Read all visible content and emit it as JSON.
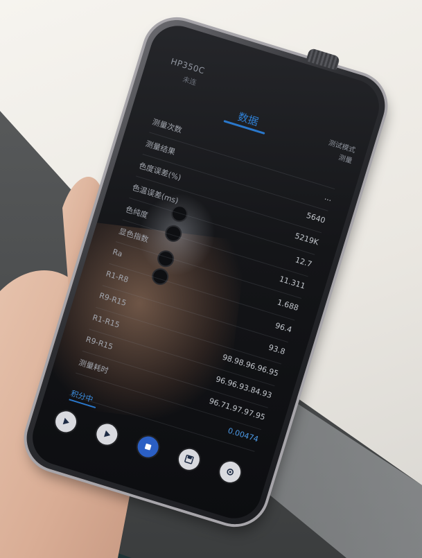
{
  "device": {
    "model": "HP350C",
    "sub_label": "未连",
    "tab": "数据",
    "top_right": [
      "测试模式",
      "测量"
    ]
  },
  "readings": [
    {
      "label": "测量次数",
      "value": ""
    },
    {
      "label": "测量结果",
      "value": "..."
    },
    {
      "label": "色度误差(%)",
      "value": "5640"
    },
    {
      "label": "色温误差(ms)",
      "value": "5219K"
    },
    {
      "label": "色纯度",
      "value": "12.7"
    },
    {
      "label": "显色指数",
      "value": "11.311"
    },
    {
      "label": "Ra",
      "value": "1.688"
    },
    {
      "label": "R1-R8",
      "value": "96.4"
    },
    {
      "label": "R9-R15",
      "value": "93.8"
    },
    {
      "label": "R1-R15",
      "value": "98.98.96.96.95"
    },
    {
      "label": "R9-R15",
      "value": "96.96.93.84.93"
    },
    {
      "label": "测量耗时",
      "value": "96.71.97.97.95"
    },
    {
      "label": "",
      "value": "0.00474"
    }
  ],
  "status_text": "积分中",
  "colors": {
    "accent": "#2f7fd3",
    "screen": "#141518",
    "bezel": "#a7a5aa"
  },
  "controls": [
    "play-icon",
    "play-icon",
    "stop-icon",
    "save-icon",
    "settings-icon"
  ]
}
